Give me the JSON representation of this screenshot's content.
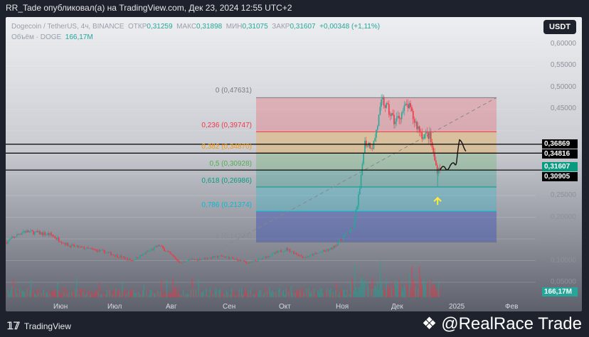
{
  "header": {
    "publisher_line": "RR_Tade опубликовал(а) на TradingView.com, Дек 23, 2024 12:55 UTC+2"
  },
  "legend": {
    "symbol": "Dogecoin / TetherUS, 4ч, BINANCE",
    "open_label": "ОТКР",
    "open": "0,31259",
    "high_label": "МАКС",
    "high": "0,31898",
    "low_label": "МИН",
    "low": "0,31075",
    "close_label": "ЗАКР",
    "close": "0,31607",
    "change": "+0,00348 (+1,11%)",
    "volume_label": "Объём · DOGE",
    "volume": "166,17M"
  },
  "currency_button": "USDT",
  "price_axis": [
    "0,60000",
    "0,55000",
    "0,50000",
    "0,45000",
    "0,25000",
    "0,20000",
    "0,15000",
    "0,10000",
    "0,05000"
  ],
  "price_tags": {
    "line1": "0,36869",
    "line2": "0,34816",
    "last": "0,31607",
    "line3": "0,30905",
    "volume": "166,17M"
  },
  "fib_levels": [
    {
      "label": "0 (0,47631)",
      "value": 0.47631,
      "color": "#787b86"
    },
    {
      "label": "0,236 (0,39747)",
      "value": 0.39747,
      "color": "#f23645"
    },
    {
      "label": "0,382 (0,34870)",
      "value": 0.3487,
      "color": "#ff9800"
    },
    {
      "label": "0,5 (0,30928)",
      "value": 0.30928,
      "color": "#4caf50"
    },
    {
      "label": "0,618 (0,26986)",
      "value": 0.26986,
      "color": "#089981"
    },
    {
      "label": "0,786 (0,21374)",
      "value": 0.21374,
      "color": "#00bcd4"
    },
    {
      "label": "1 (0,14224)",
      "value": 0.14224,
      "color": "#787b86"
    }
  ],
  "time_axis": [
    "Июн",
    "Июл",
    "Авг",
    "Сен",
    "Окт",
    "Ноя",
    "Дек",
    "2025",
    "Фев"
  ],
  "chart_data": {
    "type": "candlestick",
    "symbol": "DOGEUSDT",
    "interval": "4h",
    "ylim": [
      0.02,
      0.62
    ],
    "price_path": [
      [
        1,
        0.143
      ],
      [
        10,
        0.168
      ],
      [
        25,
        0.16
      ],
      [
        35,
        0.135
      ],
      [
        55,
        0.12
      ],
      [
        70,
        0.1
      ],
      [
        85,
        0.135
      ],
      [
        97,
        0.094
      ],
      [
        100,
        0.1
      ],
      [
        120,
        0.11
      ],
      [
        135,
        0.094
      ],
      [
        155,
        0.127
      ],
      [
        165,
        0.107
      ],
      [
        180,
        0.127
      ],
      [
        188,
        0.16
      ],
      [
        192,
        0.176
      ],
      [
        196,
        0.275
      ],
      [
        198,
        0.373
      ],
      [
        203,
        0.365
      ],
      [
        208,
        0.47
      ],
      [
        215,
        0.42
      ],
      [
        222,
        0.46
      ],
      [
        226,
        0.42
      ],
      [
        230,
        0.39
      ],
      [
        234,
        0.39
      ],
      [
        238,
        0.31
      ],
      [
        240,
        0.316
      ]
    ],
    "horizontal_lines": [
      0.36869,
      0.34816,
      0.30905
    ]
  },
  "footer": {
    "brand": "TradingView",
    "watermark": "@RealRace Trade"
  },
  "colors": {
    "up": "#26a69a",
    "down": "#f23645"
  }
}
